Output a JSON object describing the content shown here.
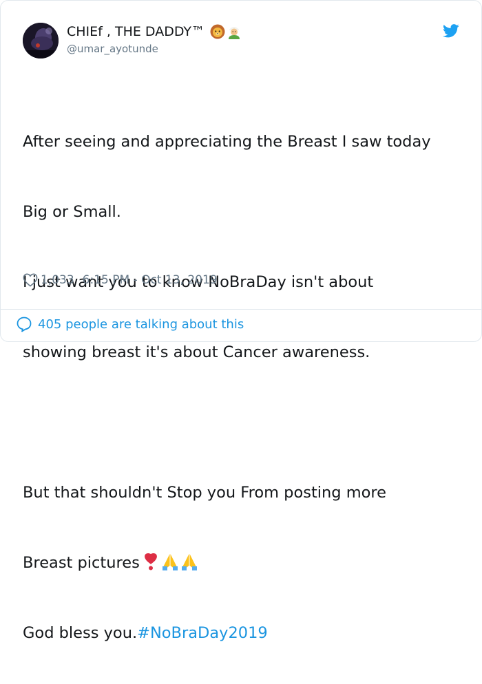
{
  "user": {
    "display_name": "CHIEf , THE DADDY™",
    "handle": "@umar_ayotunde",
    "name_emojis": [
      "lion-face",
      "man-with-turban"
    ]
  },
  "tweet": {
    "lines": [
      "After seeing and appreciating the Breast I saw today",
      "Big or Small.",
      "I just want you to know NoBraDay isn't about",
      "showing breast it's about Cancer awareness.",
      "",
      "But that shouldn't Stop you From posting more",
      "Breast pictures"
    ],
    "last_line_text": "God bless you.",
    "hashtag": "#NoBraDay2019",
    "inline_emojis": [
      "heavy-heart-exclamation",
      "folded-hands",
      "folded-hands"
    ]
  },
  "meta": {
    "likes": "1,033",
    "timestamp": "6:15 PM - Oct 13, 2019"
  },
  "footer": {
    "conversation_label": "405 people are talking about this"
  },
  "colors": {
    "text": "#14171a",
    "secondary": "#657786",
    "link": "#1b95e0",
    "border": "#e1e8ed"
  }
}
